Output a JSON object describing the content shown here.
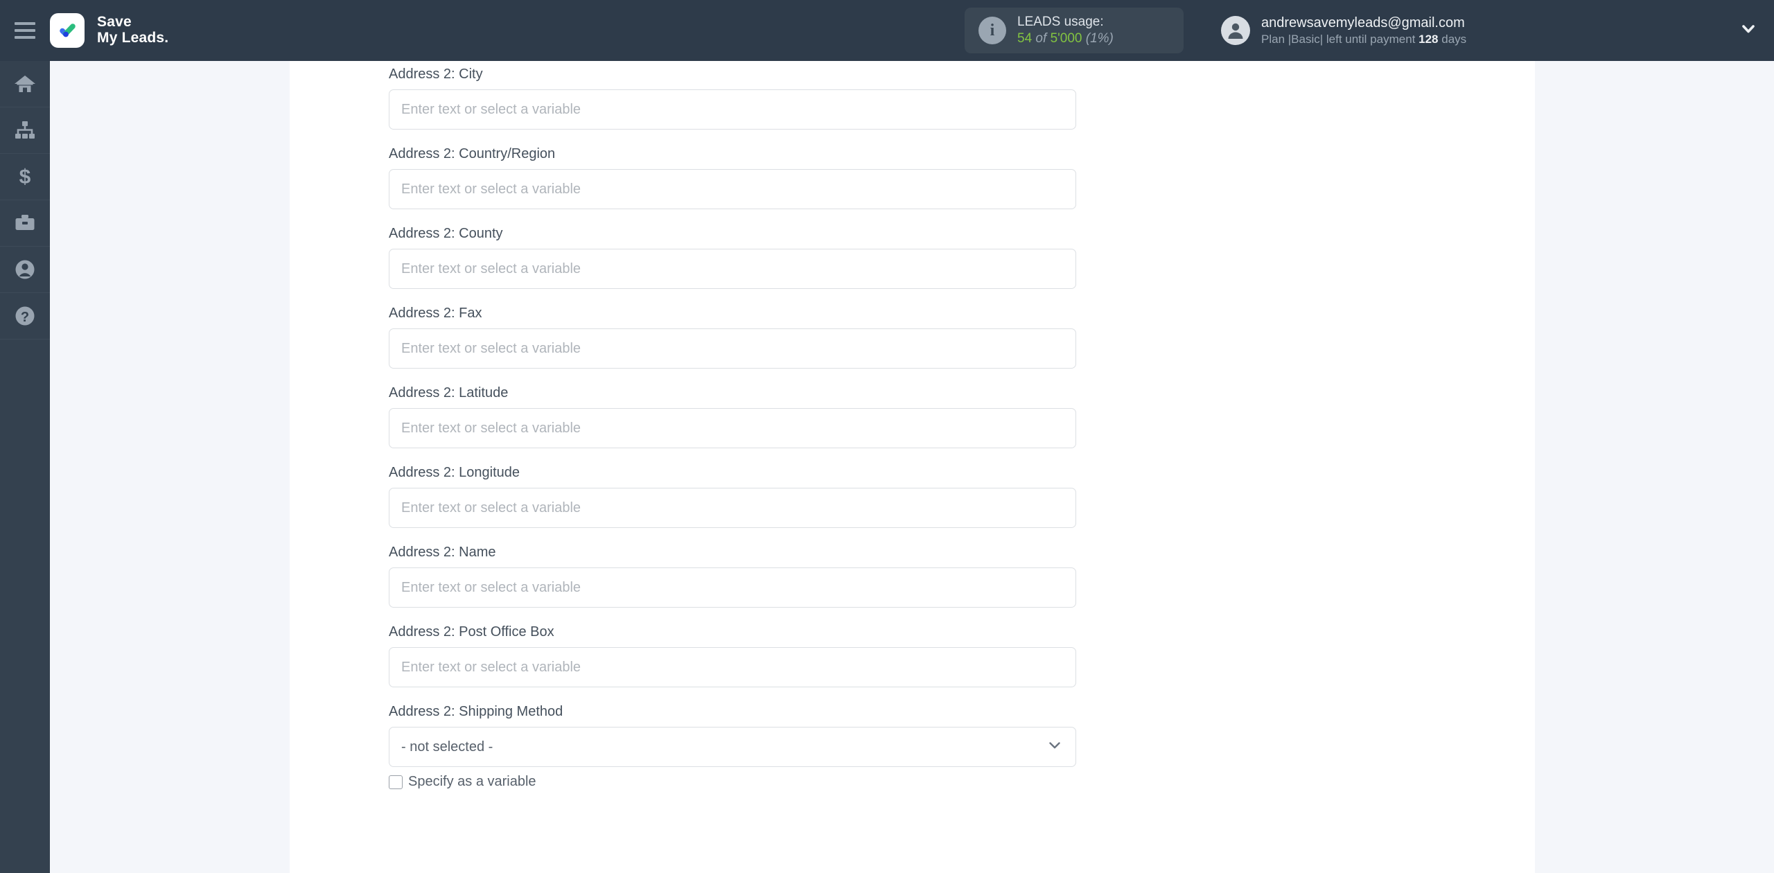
{
  "header": {
    "menu_icon": "hamburger-icon",
    "brand_line1": "Save",
    "brand_line2": "My Leads.",
    "logo_icon": "checkmark-logo-icon",
    "usage": {
      "info_icon": "info-icon",
      "title": "LEADS usage:",
      "used": "54",
      "of": "of",
      "total": "5'000",
      "percent": "(1%)",
      "accent_color": "#82c341"
    },
    "account": {
      "avatar_icon": "user-avatar-icon",
      "email": "andrewsavemyleads@gmail.com",
      "plan_prefix": "Plan |Basic| left until payment",
      "days_value": "128",
      "days_suffix": "days",
      "caret_icon": "chevron-down-icon"
    }
  },
  "sidebar": {
    "items": [
      {
        "name": "home",
        "icon": "home-icon"
      },
      {
        "name": "connections",
        "icon": "sitemap-icon"
      },
      {
        "name": "billing",
        "icon": "dollar-icon"
      },
      {
        "name": "services",
        "icon": "briefcase-icon"
      },
      {
        "name": "account",
        "icon": "user-circle-icon"
      },
      {
        "name": "help",
        "icon": "question-circle-icon"
      }
    ]
  },
  "form": {
    "placeholder": "Enter text or select a variable",
    "fields": [
      {
        "label": "Address 2: City",
        "type": "text",
        "value": ""
      },
      {
        "label": "Address 2: Country/Region",
        "type": "text",
        "value": ""
      },
      {
        "label": "Address 2: County",
        "type": "text",
        "value": ""
      },
      {
        "label": "Address 2: Fax",
        "type": "text",
        "value": ""
      },
      {
        "label": "Address 2: Latitude",
        "type": "text",
        "value": ""
      },
      {
        "label": "Address 2: Longitude",
        "type": "text",
        "value": ""
      },
      {
        "label": "Address 2: Name",
        "type": "text",
        "value": ""
      },
      {
        "label": "Address 2: Post Office Box",
        "type": "text",
        "value": ""
      },
      {
        "label": "Address 2: Shipping Method",
        "type": "select",
        "value": "- not selected -"
      }
    ],
    "select_caret_icon": "chevron-down-icon",
    "checkbox": {
      "label": "Specify as a variable",
      "checked": false
    }
  },
  "colors": {
    "header_bg": "#2e3b4a",
    "sidebar_bg": "#34414f",
    "page_bg": "#f4f6fa",
    "card_bg": "#ffffff",
    "label_text": "#45505c",
    "placeholder": "#b0b5bb",
    "border": "#dcdfe3"
  }
}
